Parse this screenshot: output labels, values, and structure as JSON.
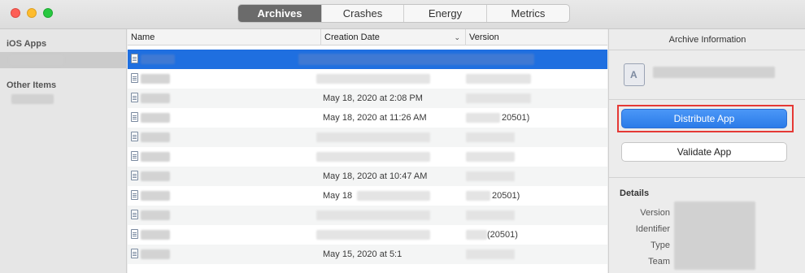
{
  "toolbar": {
    "tabs": [
      {
        "label": "Archives",
        "active": true
      },
      {
        "label": "Crashes",
        "active": false
      },
      {
        "label": "Energy",
        "active": false
      },
      {
        "label": "Metrics",
        "active": false
      }
    ]
  },
  "sidebar": {
    "sections": [
      {
        "header": "iOS Apps"
      },
      {
        "header": "Other Items"
      }
    ]
  },
  "table": {
    "columns": {
      "name": "Name",
      "creation_date": "Creation Date",
      "version": "Version"
    },
    "sort_icon": "chevron-down-icon",
    "rows": [
      {
        "date": "",
        "version": ""
      },
      {
        "date": "",
        "version": ""
      },
      {
        "date": "May 18, 2020 at 2:08 PM",
        "version": ""
      },
      {
        "date": "May 18, 2020 at 11:26 AM",
        "version": "20501)"
      },
      {
        "date": "",
        "version": ""
      },
      {
        "date": "",
        "version": ""
      },
      {
        "date": "May 18, 2020 at 10:47 AM",
        "version": ""
      },
      {
        "date": "May 18",
        "version": "20501)"
      },
      {
        "date": "",
        "version": ""
      },
      {
        "date": "",
        "version": "(20501)"
      },
      {
        "date": "May 15, 2020 at 5:1",
        "version": ""
      }
    ]
  },
  "inspector": {
    "title": "Archive Information",
    "distribute_label": "Distribute App",
    "validate_label": "Validate App",
    "details_header": "Details",
    "details": [
      {
        "label": "Version"
      },
      {
        "label": "Identifier"
      },
      {
        "label": "Type"
      },
      {
        "label": "Team"
      }
    ]
  },
  "colors": {
    "selection": "#1f6fe0",
    "primary_button": "#2b7be8",
    "highlight_box": "#e53935",
    "active_tab": "#6b6b6b"
  }
}
